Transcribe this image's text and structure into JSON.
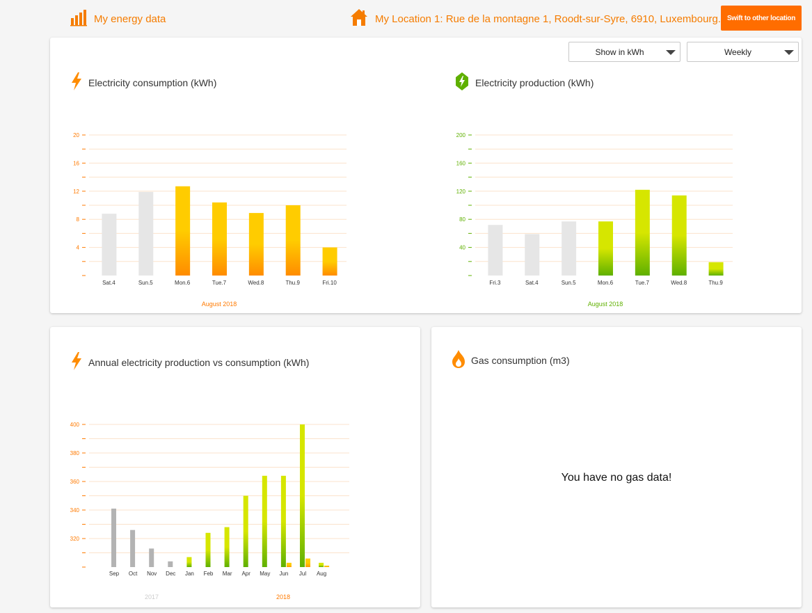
{
  "header": {
    "brand_label": "My energy data",
    "location_label": "My Location 1: Rue de la montagne 1, Roodt-sur-Syre, 6910, Luxembourg.",
    "switch_button_label": "Swift to other location",
    "brand_icon": "bar-chart-icon",
    "location_icon": "home-icon"
  },
  "controls": {
    "unit_select": "Show in kWh",
    "period_select": "Weekly"
  },
  "colors": {
    "accent": "#ff6d00",
    "consumption_bar": "#ffcc00",
    "production_bar": "#cfe000",
    "inactive_bar": "#e6e6e6",
    "annual_inactive_bar": "#b3b3b3",
    "production_label": "#5fb000"
  },
  "consumption": {
    "title": "Electricity consumption (kWh)",
    "icon": "lightning-icon",
    "period_label": "August 2018"
  },
  "production": {
    "title": "Electricity production (kWh)",
    "icon": "lightning-badge-icon",
    "period_label": "August 2018"
  },
  "annual": {
    "title": "Annual electricity production vs consumption (kWh)",
    "icon": "lightning-icon",
    "year_labels": [
      "2017",
      "2018"
    ]
  },
  "gas": {
    "title": "Gas consumption (m3)",
    "icon": "flame-icon",
    "empty_message": "You have no gas data!"
  },
  "chart_data": [
    {
      "type": "bar",
      "title": "Electricity consumption (kWh)",
      "xlabel": "August 2018",
      "categories": [
        "Sat.4",
        "Sun.5",
        "Mon.6",
        "Tue.7",
        "Wed.8",
        "Thu.9",
        "Fri.10"
      ],
      "values": [
        8.8,
        11.9,
        12.7,
        10.4,
        8.9,
        10.0,
        4.0
      ],
      "highlighted": [
        false,
        false,
        true,
        true,
        true,
        true,
        true
      ],
      "ylim": [
        0,
        20
      ],
      "yticks": [
        "20",
        "16",
        "12",
        "8",
        "4"
      ],
      "grid": true
    },
    {
      "type": "bar",
      "title": "Electricity production (kWh)",
      "xlabel": "August 2018",
      "categories": [
        "Fri.3",
        "Sat.4",
        "Sun.5",
        "Mon.6",
        "Tue.7",
        "Wed.8",
        "Thu.9"
      ],
      "values": [
        72,
        59,
        77,
        77,
        122,
        114,
        19
      ],
      "highlighted": [
        false,
        false,
        false,
        true,
        true,
        true,
        true
      ],
      "ylim": [
        0,
        200
      ],
      "yticks": [
        "200",
        "160",
        "120",
        "80",
        "40"
      ],
      "grid": true
    },
    {
      "type": "bar",
      "title": "Annual electricity production vs consumption (kWh)",
      "categories": [
        "Sep",
        "Oct",
        "Nov",
        "Dec",
        "Jan",
        "Feb",
        "Mar",
        "Apr",
        "May",
        "Jun",
        "Jul",
        "Aug"
      ],
      "ylim": [
        300,
        400
      ],
      "yticks": [
        "400",
        "380",
        "360",
        "340",
        "320"
      ],
      "series": [
        {
          "name": "production",
          "values": [
            341,
            326,
            313,
            304,
            307,
            324,
            328,
            350,
            364,
            364,
            400,
            303
          ]
        },
        {
          "name": "consumption",
          "values": [
            null,
            null,
            null,
            null,
            null,
            null,
            null,
            null,
            null,
            303,
            306,
            301
          ]
        }
      ],
      "highlighted": [
        false,
        false,
        false,
        false,
        true,
        true,
        true,
        true,
        true,
        true,
        true,
        true
      ],
      "grid": true
    }
  ]
}
